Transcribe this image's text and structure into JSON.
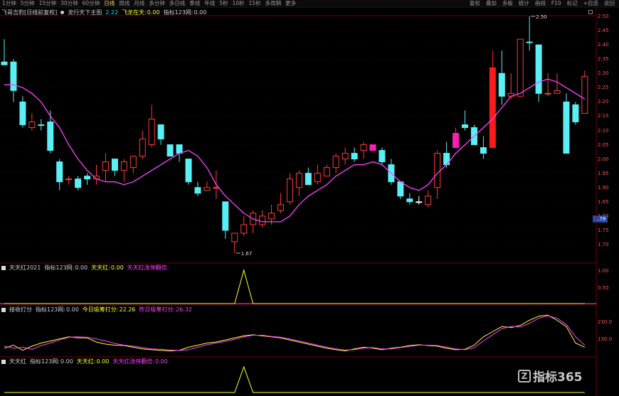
{
  "toolbar": {
    "periods": [
      "1分钟",
      "5分钟",
      "15分钟",
      "30分钟",
      "60分钟",
      "日线",
      "周线",
      "月线",
      "多分钟",
      "多日线",
      "季线",
      "年线",
      "5秒",
      "10秒",
      "15秒",
      "多周期",
      "更多"
    ],
    "active_period": "日线",
    "right_buttons": [
      "复权",
      "叠加",
      "多股",
      "统计",
      "画线",
      "F10",
      "标记",
      "+自选",
      "返回"
    ]
  },
  "main_pane": {
    "title": "飞哥吉豹[日线前复权]",
    "indicator_name": "龙行天下主图",
    "values": [
      {
        "label": "",
        "value": "2.22",
        "color": "#00e5ff"
      },
      {
        "label": "飞龙在天:",
        "value": "0.00",
        "color": "#ffff33"
      },
      {
        "label": "指标123网:",
        "value": "0.00",
        "color": "#cfcfcf"
      }
    ],
    "price_tag": "1.78",
    "high_label": "2.50",
    "low_label": "1.67",
    "y_ticks": [
      "2.50",
      "2.45",
      "2.40",
      "2.35",
      "2.30",
      "2.25",
      "2.20",
      "2.15",
      "2.10",
      "2.05",
      "2.00",
      "1.95",
      "1.90",
      "1.85",
      "1.80",
      "1.75",
      "1.70"
    ]
  },
  "sub1": {
    "name": "天天红2021",
    "values": [
      {
        "label": "指标123网:",
        "value": "0.00",
        "color": "#cfcfcf"
      },
      {
        "label": "天天红:",
        "value": "0.00",
        "color": "#ffff33"
      },
      {
        "label": "天天红涨停翻倍:",
        "value": "",
        "color": "#ff40ff"
      }
    ],
    "y_ticks": [
      "1.00",
      "0.50"
    ]
  },
  "sub2": {
    "name": "接收打分",
    "values": [
      {
        "label": "指标123网:",
        "value": "0.00",
        "color": "#cfcfcf"
      },
      {
        "label": "今日吸筹打分:",
        "value": "22.26",
        "color": "#ffff33"
      },
      {
        "label": "昨日吸筹打分:",
        "value": "26.32",
        "color": "#ff40ff"
      }
    ],
    "y_ticks": [
      "230.0",
      "130.0"
    ]
  },
  "sub3": {
    "name": "天天红",
    "values": [
      {
        "label": "指标123网:",
        "value": "0.00",
        "color": "#cfcfcf"
      },
      {
        "label": "天天红:",
        "value": "0.00",
        "color": "#ffff33"
      },
      {
        "label": "天天红涨停翻倍:",
        "value": "0.00",
        "color": "#ff40ff"
      }
    ]
  },
  "logo_text": "指标365",
  "colors": {
    "up": "#ff3b3b",
    "down": "#58f0f5",
    "ma": "#ff40ff",
    "alt": "#ff1eb4",
    "limit": "#ff1a1a",
    "yellow": "#ffff33",
    "pink": "#ff40ff"
  },
  "chart_data": [
    {
      "type": "candlestick",
      "ylim": [
        1.65,
        2.52
      ],
      "candles": [
        [
          2.33,
          2.34,
          2.42,
          2.33,
          "d"
        ],
        [
          2.34,
          2.24,
          2.35,
          2.2,
          "d"
        ],
        [
          2.2,
          2.12,
          2.22,
          2.11,
          "d"
        ],
        [
          2.11,
          2.13,
          2.16,
          2.1,
          "u"
        ],
        [
          2.12,
          2.12,
          2.14,
          2.1,
          "d"
        ],
        [
          2.13,
          2.03,
          2.17,
          2.02,
          "d"
        ],
        [
          1.99,
          1.92,
          2.0,
          1.89,
          "d"
        ],
        [
          1.93,
          1.93,
          1.94,
          1.91,
          "u"
        ],
        [
          1.93,
          1.9,
          1.94,
          1.89,
          "d"
        ],
        [
          1.93,
          1.94,
          1.95,
          1.91,
          "d"
        ],
        [
          1.94,
          1.93,
          1.98,
          1.91,
          "u"
        ],
        [
          1.96,
          1.99,
          2.02,
          1.92,
          "u"
        ],
        [
          2.0,
          1.96,
          2.0,
          1.94,
          "d"
        ],
        [
          1.96,
          1.99,
          2.0,
          1.92,
          "u"
        ],
        [
          1.97,
          2.01,
          2.01,
          1.95,
          "u"
        ],
        [
          2.01,
          2.07,
          2.1,
          2.0,
          "u"
        ],
        [
          2.05,
          2.14,
          2.19,
          2.04,
          "u"
        ],
        [
          2.12,
          2.07,
          2.12,
          2.05,
          "d"
        ],
        [
          2.05,
          2.01,
          2.05,
          2.01,
          "d"
        ],
        [
          2.05,
          2.02,
          2.05,
          1.99,
          "d"
        ],
        [
          2.0,
          1.92,
          2.0,
          1.91,
          "d"
        ],
        [
          1.9,
          1.88,
          1.92,
          1.87,
          "d"
        ],
        [
          1.89,
          1.9,
          1.92,
          1.89,
          "u"
        ],
        [
          1.9,
          1.9,
          1.96,
          1.86,
          "u"
        ],
        [
          1.85,
          1.75,
          1.85,
          1.72,
          "d"
        ],
        [
          1.71,
          1.74,
          1.74,
          1.67,
          "u"
        ],
        [
          1.74,
          1.77,
          1.8,
          1.73,
          "u"
        ],
        [
          1.77,
          1.81,
          1.82,
          1.74,
          "u"
        ],
        [
          1.8,
          1.77,
          1.82,
          1.76,
          "u"
        ],
        [
          1.79,
          1.81,
          1.84,
          1.77,
          "u"
        ],
        [
          1.82,
          1.84,
          1.88,
          1.81,
          "u"
        ],
        [
          1.85,
          1.93,
          1.95,
          1.84,
          "u"
        ],
        [
          1.9,
          1.95,
          1.96,
          1.87,
          "u"
        ],
        [
          1.95,
          1.91,
          1.97,
          1.91,
          "d"
        ],
        [
          1.92,
          1.95,
          1.98,
          1.91,
          "u"
        ],
        [
          1.94,
          1.97,
          1.98,
          1.94,
          "u"
        ],
        [
          1.97,
          2.01,
          2.02,
          1.95,
          "u"
        ],
        [
          2.0,
          2.02,
          2.04,
          1.98,
          "u"
        ],
        [
          2.02,
          2.0,
          2.04,
          1.99,
          "d"
        ],
        [
          2.03,
          2.05,
          2.06,
          2.0,
          "u"
        ],
        [
          2.03,
          2.05,
          2.03,
          2.03,
          "p"
        ],
        [
          2.03,
          1.99,
          2.04,
          1.98,
          "d"
        ],
        [
          1.98,
          1.92,
          2.0,
          1.91,
          "d"
        ],
        [
          1.92,
          1.87,
          1.92,
          1.86,
          "d"
        ],
        [
          1.86,
          1.85,
          1.88,
          1.84,
          "d"
        ],
        [
          1.85,
          1.85,
          1.87,
          1.84,
          "w"
        ],
        [
          1.84,
          1.87,
          1.89,
          1.83,
          "u"
        ],
        [
          1.9,
          2.02,
          2.03,
          1.86,
          "u"
        ],
        [
          2.02,
          1.98,
          2.06,
          1.97,
          "d"
        ],
        [
          2.04,
          2.09,
          2.11,
          2.04,
          "p"
        ],
        [
          2.12,
          2.11,
          2.17,
          2.1,
          "d"
        ],
        [
          2.11,
          2.05,
          2.12,
          2.05,
          "d"
        ],
        [
          2.04,
          2.02,
          2.08,
          2.0,
          "d"
        ],
        [
          2.04,
          2.32,
          2.38,
          2.04,
          "l"
        ],
        [
          2.3,
          2.22,
          2.38,
          2.19,
          "d"
        ],
        [
          2.22,
          2.23,
          2.3,
          2.21,
          "u"
        ],
        [
          2.22,
          2.42,
          2.42,
          2.22,
          "u"
        ],
        [
          2.41,
          2.41,
          2.5,
          2.38,
          "d"
        ],
        [
          2.4,
          2.23,
          2.4,
          2.2,
          "d"
        ],
        [
          2.23,
          2.23,
          2.3,
          2.22,
          "u"
        ],
        [
          2.24,
          2.23,
          2.3,
          2.23,
          "u"
        ],
        [
          2.2,
          2.02,
          2.23,
          2.02,
          "d"
        ],
        [
          2.19,
          2.13,
          2.2,
          2.12,
          "d"
        ],
        [
          2.16,
          2.29,
          2.31,
          2.16,
          "u"
        ]
      ],
      "ma": [
        2.26,
        2.26,
        2.25,
        2.23,
        2.2,
        2.15,
        2.11,
        2.05,
        2.0,
        1.96,
        1.93,
        1.92,
        1.92,
        1.91,
        1.92,
        1.94,
        1.96,
        1.98,
        2.0,
        2.02,
        2.03,
        2.01,
        1.97,
        1.91,
        1.87,
        1.84,
        1.81,
        1.79,
        1.78,
        1.78,
        1.78,
        1.8,
        1.84,
        1.87,
        1.89,
        1.91,
        1.94,
        1.96,
        1.98,
        1.98,
        1.99,
        1.98,
        1.95,
        1.92,
        1.9,
        1.89,
        1.91,
        1.95,
        1.98,
        2.02,
        2.05,
        2.08,
        2.11,
        2.14,
        2.18,
        2.22,
        2.23,
        2.25,
        2.27,
        2.28,
        2.27,
        2.25,
        2.23,
        2.21
      ]
    },
    {
      "type": "line",
      "name": "sub1",
      "ylim": [
        0,
        1.2
      ],
      "series": [
        {
          "values": [
            0,
            0,
            0,
            0,
            0,
            0,
            0,
            0,
            0,
            0,
            0,
            0,
            0,
            0,
            0,
            0,
            0,
            0,
            0,
            0,
            0,
            0,
            0,
            0,
            0,
            0,
            1,
            0,
            0,
            0,
            0,
            0,
            0,
            0,
            0,
            0,
            0,
            0,
            0,
            0,
            0,
            0,
            0,
            0,
            0,
            0,
            0,
            0,
            0,
            0,
            0,
            0,
            0,
            0,
            0,
            0,
            0,
            0,
            0,
            0,
            0,
            0,
            0,
            0
          ]
        }
      ]
    },
    {
      "type": "line",
      "name": "sub2",
      "ylim": [
        60,
        280
      ],
      "series": [
        {
          "values": [
            95,
            110,
            85,
            105,
            120,
            130,
            140,
            150,
            145,
            145,
            125,
            115,
            110,
            108,
            100,
            92,
            88,
            85,
            82,
            85,
            100,
            110,
            120,
            125,
            135,
            145,
            155,
            160,
            155,
            150,
            145,
            135,
            125,
            115,
            105,
            95,
            88,
            82,
            92,
            100,
            95,
            88,
            95,
            100,
            108,
            112,
            108,
            105,
            95,
            88,
            90,
            110,
            150,
            175,
            200,
            195,
            205,
            230,
            250,
            255,
            230,
            200,
            120,
            100
          ]
        },
        {
          "values": [
            105,
            95,
            100,
            90,
            108,
            120,
            135,
            148,
            150,
            148,
            140,
            130,
            118,
            110,
            105,
            98,
            92,
            90,
            86,
            84,
            88,
            100,
            112,
            120,
            128,
            138,
            150,
            158,
            158,
            152,
            148,
            140,
            130,
            120,
            110,
            100,
            92,
            86,
            88,
            95,
            98,
            92,
            92,
            98,
            104,
            110,
            110,
            108,
            100,
            92,
            88,
            98,
            130,
            160,
            190,
            200,
            198,
            215,
            240,
            252,
            240,
            210,
            150,
            110
          ]
        }
      ]
    },
    {
      "type": "line",
      "name": "sub3",
      "ylim": [
        0,
        1.2
      ],
      "series": [
        {
          "values": [
            0,
            0,
            0,
            0,
            0,
            0,
            0,
            0,
            0,
            0,
            0,
            0,
            0,
            0,
            0,
            0,
            0,
            0,
            0,
            0,
            0,
            0,
            0,
            0,
            0,
            0,
            1,
            0,
            0,
            0,
            0,
            0,
            0,
            0,
            0,
            0,
            0,
            0,
            0,
            0,
            0,
            0,
            0,
            0,
            0,
            0,
            0,
            0,
            0,
            0,
            0,
            0,
            0,
            0,
            0,
            0,
            0,
            0,
            0,
            0,
            0,
            0,
            0,
            0
          ]
        }
      ]
    }
  ]
}
